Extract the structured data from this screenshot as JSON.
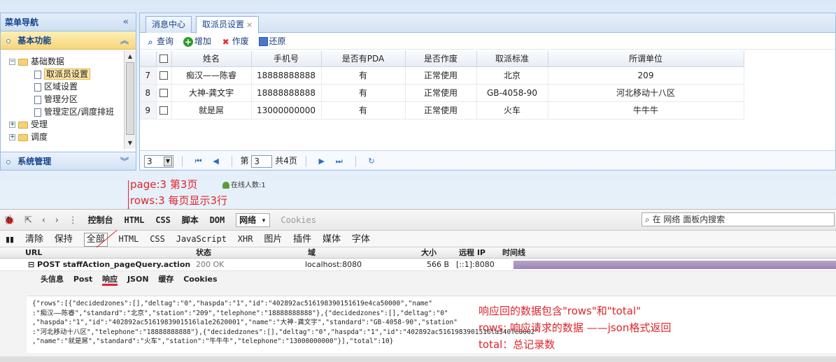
{
  "sidebar": {
    "title": "菜单导航",
    "collapse_icon": "«",
    "sections": [
      {
        "label": "基本功能",
        "chevron": "︽"
      },
      {
        "label": "系统管理",
        "chevron": "︾"
      }
    ],
    "tree": [
      {
        "label": "基础数据",
        "toggle": "⊟"
      },
      {
        "label": "取派员设置"
      },
      {
        "label": "区域设置"
      },
      {
        "label": "管理分区"
      },
      {
        "label": "管理定区/调度排班"
      },
      {
        "label": "受理",
        "toggle": "⊞"
      },
      {
        "label": "调度",
        "toggle": "⊞"
      }
    ]
  },
  "main": {
    "tabs": [
      {
        "label": "消息中心"
      },
      {
        "label": "取派员设置",
        "close": "×"
      }
    ],
    "toolbar": {
      "search": "查询",
      "add": "增加",
      "delete": "作废",
      "restore": "还原"
    },
    "table": {
      "headers": [
        "姓名",
        "手机号",
        "是否有PDA",
        "是否作废",
        "取派标准",
        "所谓单位"
      ],
      "rows": [
        {
          "num": "7",
          "name": "痴汉——陈睿",
          "phone": "18888888888",
          "pda": "有",
          "status": "正常使用",
          "standard": "北京",
          "unit": "209"
        },
        {
          "num": "8",
          "name": "大神-龚文宇",
          "phone": "18888888888",
          "pda": "有",
          "status": "正常使用",
          "standard": "GB-4058-90",
          "unit": "河北移动十八区"
        },
        {
          "num": "9",
          "name": "就是屌",
          "phone": "13000000000",
          "pda": "有",
          "status": "正常使用",
          "standard": "火车",
          "unit": "牛牛牛"
        }
      ]
    },
    "pager": {
      "page_size": "3",
      "page_prefix": "第",
      "page_value": "3",
      "page_suffix": "共4页"
    }
  },
  "annotations": {
    "page_note": "page:3  第3页",
    "rows_note": "rows:3  每页显示3行",
    "online": "在线人数:1",
    "resp_note_1": "响应回的数据包含\"rows\"和\"total\"",
    "resp_note_2": "rows: 响应请求的数据 ——json格式返回",
    "resp_note_3": "total：总记录数"
  },
  "devtools": {
    "tabs": [
      "控制台",
      "HTML",
      "CSS",
      "脚本",
      "DOM",
      "网络 ▾",
      "Cookies"
    ],
    "search_placeholder": "在 网络 面板内搜索",
    "subtabs": [
      "清除",
      "保持",
      "全部",
      "HTML",
      "CSS",
      "JavaScript",
      "XHR",
      "图片",
      "插件",
      "媒体",
      "字体"
    ],
    "columns": {
      "url": "URL",
      "status": "状态",
      "domain": "域",
      "size": "大小",
      "remote_ip": "远程 IP",
      "timeline": "时间线"
    },
    "request": {
      "url": "⊟ POST staffAction_pageQuery.action",
      "status": "200 OK",
      "domain": "localhost:8080",
      "size": "566 B",
      "ip": "[::1]:8080"
    },
    "response_tabs": [
      "头信息",
      "Post",
      "响应",
      "JSON",
      "缓存",
      "Cookies"
    ],
    "json_lines": [
      "{\"rows\":[{\"decidedzones\":[],\"deltag\":\"0\",\"haspda\":\"1\",\"id\":\"402892ac516198390151619e4ca50000\",\"name\"",
      ":\"痴汉——陈睿\",\"standard\":\"北京\",\"station\":\"209\",\"telephone\":\"18888888888\"},{\"decidedzones\":[],\"deltag\":\"0\"",
      ",\"haspda\":\"1\",\"id\":\"402892ac5161983901516la1e2620001\",\"name\":\"大神-龚文宇\",\"standard\":\"GB-4058-90\",\"station\"",
      ":\"河北移动十八区\",\"telephone\":\"18888888888\"},{\"decidedzones\":[],\"deltag\":\"0\",\"haspda\":\"1\",\"id\":\"402892ac5161983901516la340fe0002\"",
      ",\"name\":\"就是屌\",\"standard\":\"火车\",\"station\":\"牛牛牛\",\"telephone\":\"13000000000\"}],\"total\":10}"
    ]
  }
}
